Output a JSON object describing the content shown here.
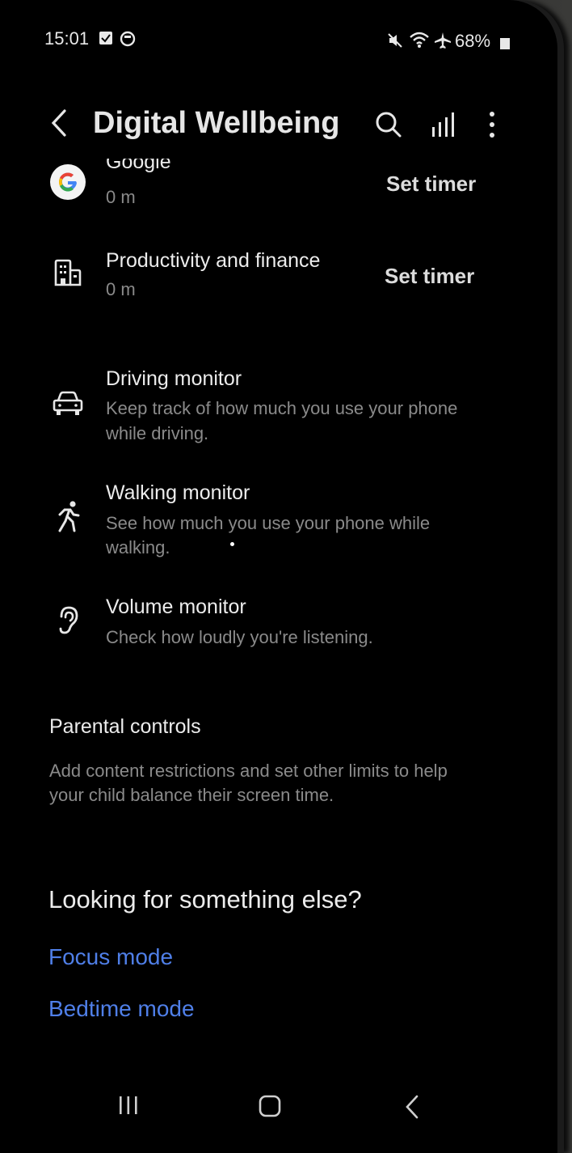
{
  "status_bar": {
    "time": "15:01",
    "battery": "68%"
  },
  "header": {
    "title": "Digital Wellbeing"
  },
  "app_rows": [
    {
      "name": "Google",
      "usage": "0 m",
      "action": "Set timer"
    },
    {
      "name": "Productivity and finance",
      "usage": "0 m",
      "action": "Set timer"
    }
  ],
  "monitors": [
    {
      "title": "Driving monitor",
      "desc_line1": "Keep track of how much you use your phone",
      "desc_line2": "while driving."
    },
    {
      "title": "Walking monitor",
      "desc_line1": "See how much you use your phone while",
      "desc_line2": "walking."
    },
    {
      "title": "Volume monitor",
      "desc_line1": "Check how loudly you're listening."
    }
  ],
  "parental": {
    "title": "Parental controls",
    "desc_line1": "Add content restrictions and set other limits to help",
    "desc_line2": "your child balance their screen time."
  },
  "suggestions": {
    "heading": "Looking for something else?",
    "links": [
      "Focus mode",
      "Bedtime mode"
    ]
  },
  "colors": {
    "background": "#000000",
    "link": "#4f7fe8",
    "subtext": "#8a8a8a"
  }
}
